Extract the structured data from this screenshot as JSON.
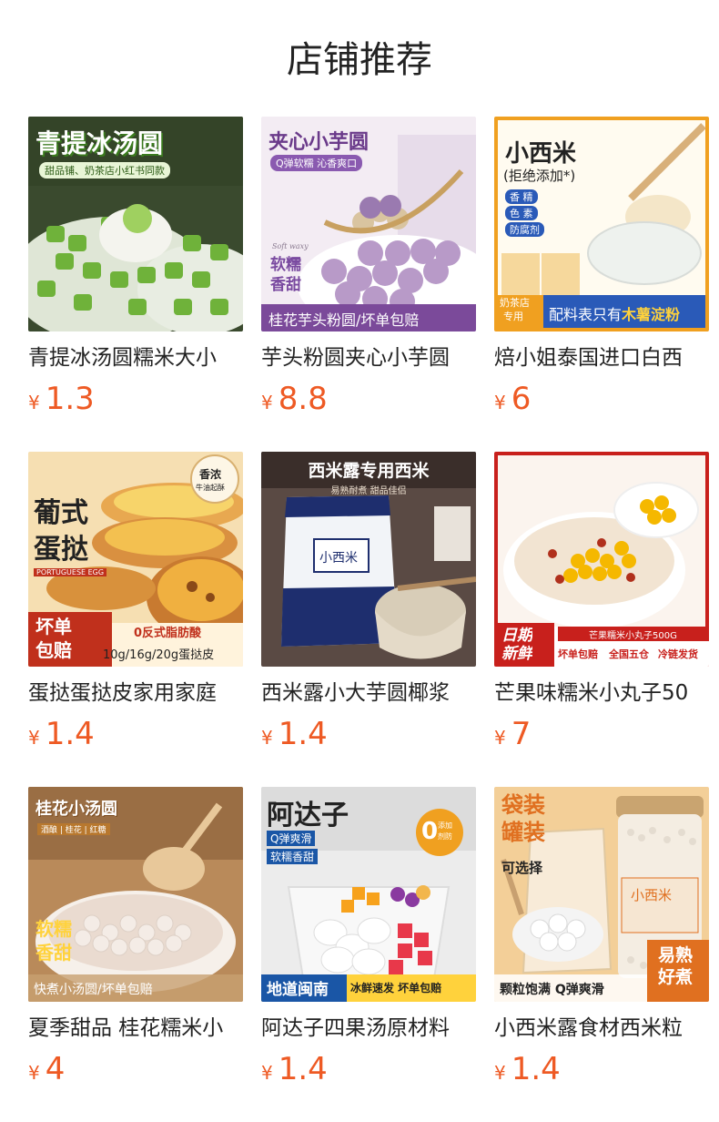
{
  "page": {
    "title": "店铺推荐"
  },
  "currency_symbol": "¥",
  "products": [
    {
      "name": "青提冰汤圆糯米大小",
      "price": "1.3",
      "image": {
        "headline": "青提冰汤圆",
        "tag": "甜品铺、奶茶店小红书同款",
        "colors": {
          "bg": "#2f4a24",
          "accent": "#7fc24a",
          "text": "#ffffff"
        }
      }
    },
    {
      "name": "芋头粉圆夹心小芋圆",
      "price": "8.8",
      "image": {
        "headline": "夹心小芋圆",
        "tag": "Q弹软糯 沁香爽口",
        "script": "Soft waxy",
        "side": "软糯\n香甜",
        "side1": "软糯",
        "side2": "香甜",
        "banner": "桂花芋头粉圆/坏单包赔",
        "colors": {
          "bg": "#efe6f2",
          "accent": "#7a4aa0",
          "text": "#6a3a8a"
        }
      }
    },
    {
      "name": "焙小姐泰国进口白西",
      "price": "6",
      "image": {
        "headline": "小西米",
        "sub": "(拒绝添加*)",
        "checks": [
          "香 精",
          "色 素",
          "防腐剂"
        ],
        "corner": "奶茶店专用",
        "corner1": "奶茶店",
        "corner2": "专用",
        "banner_prefix": "配料表只有",
        "banner_highlight": "木薯淀粉",
        "colors": {
          "bg": "#fff8e6",
          "accent": "#f0a020",
          "blue": "#2a5ab8"
        }
      }
    },
    {
      "name": "蛋挞蛋挞皮家用家庭",
      "price": "1.4",
      "image": {
        "headline1": "葡式",
        "headline2": "蛋挞",
        "subtitle": "PORTUGUESE EGG",
        "badge1": "香浓",
        "badge2": "牛油起酥",
        "corner1": "坏单",
        "corner2": "包赔",
        "line1": "0反式脂肪酸",
        "line2": "10g/16g/20g蛋挞皮",
        "colors": {
          "bg": "#f4d9a8",
          "accent": "#c0301c"
        }
      }
    },
    {
      "name": "西米露小大芋圆椰浆",
      "price": "1.4",
      "image": {
        "headline": "西米露专用西米",
        "sub": "易熟耐煮 甜品佳侣",
        "bag_label": "小西米",
        "colors": {
          "bg": "#4a3a34",
          "bag": "#1e2e6e"
        }
      }
    },
    {
      "name": "芒果味糯米小丸子50",
      "price": "7",
      "image": {
        "corner1": "日期",
        "corner2": "新鲜",
        "top_banner": "芒果糯米小丸子500G",
        "line": "坏单包赔",
        "line2": "全国五仓",
        "line3": "冷链发货",
        "colors": {
          "bg": "#fbeee4",
          "accent": "#c8201c"
        }
      }
    },
    {
      "name": "夏季甜品 桂花糯米小",
      "price": "4",
      "image": {
        "headline": "桂花小汤圆",
        "tags": "酒酿 | 桂花 | 红糖",
        "side1": "软糯",
        "side2": "香甜",
        "banner": "快煮小汤圆/坏单包赔",
        "colors": {
          "bg": "#c89868",
          "accent": "#ffd23c"
        }
      }
    },
    {
      "name": "阿达子四果汤原材料",
      "price": "1.4",
      "image": {
        "headline": "阿达子",
        "tag1": "Q弹爽滑",
        "tag2": "软糯香甜",
        "badge_num": "0",
        "badge_text1": "添加",
        "badge_text2": "剂防",
        "banner_left": "地道闽南",
        "banner_right": "冰鲜速发 坏单包赔",
        "colors": {
          "bg": "#ececec",
          "accent": "#f0a020",
          "blue": "#1a56a6"
        }
      }
    },
    {
      "name": "小西米露食材西米粒",
      "price": "1.4",
      "image": {
        "headline1": "袋装",
        "headline2": "罐装",
        "sub": "可选择",
        "jar_label": "小西米",
        "banner": "颗粒饱满 Q弹爽滑",
        "corner1": "易熟",
        "corner2": "好煮",
        "colors": {
          "bg": "#f0c890",
          "accent": "#e07020"
        }
      }
    }
  ]
}
